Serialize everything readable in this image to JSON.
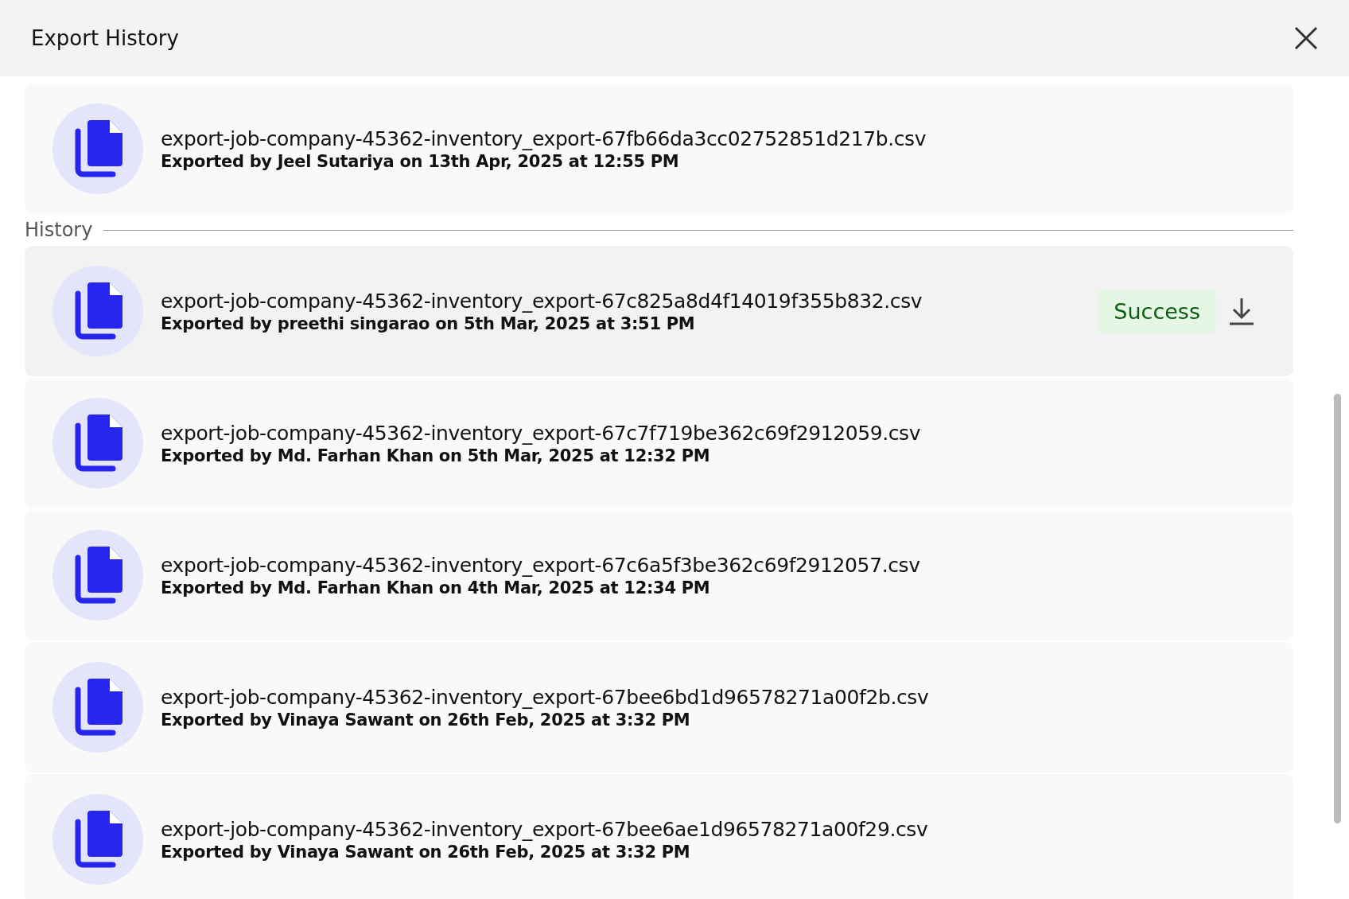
{
  "window": {
    "title": "Export History"
  },
  "current": {
    "file_name": "export-job-company-45362-inventory_export-67fb66da3cc02752851d217b.csv",
    "exported_by": "Exported by Jeel Sutariya on 13th Apr, 2025 at 12:55 PM"
  },
  "history_label": "History",
  "history": [
    {
      "file_name": "export-job-company-45362-inventory_export-67c825a8d4f14019f355b832.csv",
      "exported_by": "Exported by preethi singarao on 5th Mar, 2025 at 3:51 PM",
      "hovered": true,
      "status": "Success"
    },
    {
      "file_name": "export-job-company-45362-inventory_export-67c7f719be362c69f2912059.csv",
      "exported_by": "Exported by Md. Farhan Khan on 5th Mar, 2025 at 12:32 PM",
      "hovered": false
    },
    {
      "file_name": "export-job-company-45362-inventory_export-67c6a5f3be362c69f2912057.csv",
      "exported_by": "Exported by Md. Farhan Khan on 4th Mar, 2025 at 12:34 PM",
      "hovered": false
    },
    {
      "file_name": "export-job-company-45362-inventory_export-67bee6bd1d96578271a00f2b.csv",
      "exported_by": "Exported by Vinaya Sawant on 26th Feb, 2025 at 3:32 PM",
      "hovered": false
    },
    {
      "file_name": "export-job-company-45362-inventory_export-67bee6ae1d96578271a00f29.csv",
      "exported_by": "Exported by Vinaya Sawant on 26th Feb, 2025 at 3:32 PM",
      "hovered": false
    }
  ]
}
